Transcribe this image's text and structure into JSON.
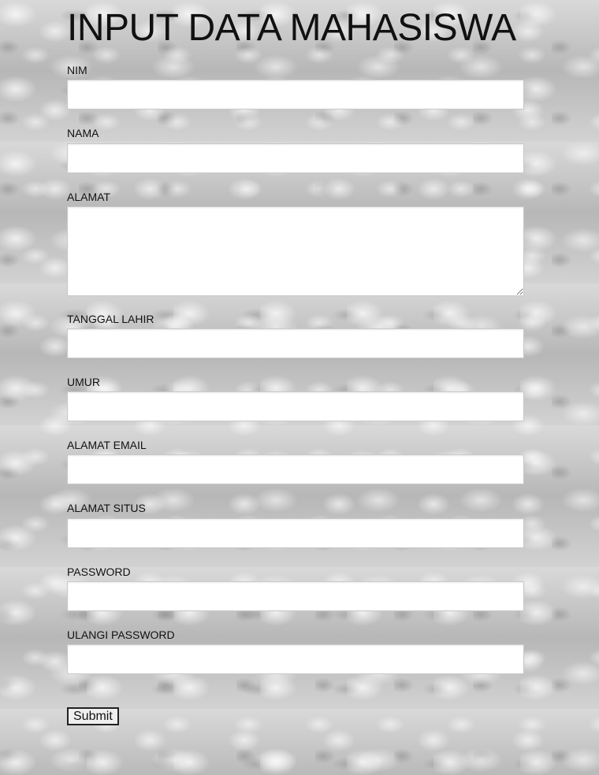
{
  "page": {
    "title": "INPUT DATA MAHASISWA"
  },
  "form": {
    "fields": [
      {
        "label": "NIM",
        "value": "",
        "placeholder": ""
      },
      {
        "label": "NAMA",
        "value": "",
        "placeholder": ""
      },
      {
        "label": "ALAMAT",
        "value": "",
        "placeholder": ""
      },
      {
        "label": "TANGGAL LAHIR",
        "value": "",
        "placeholder": ""
      },
      {
        "label": "UMUR",
        "value": "",
        "placeholder": ""
      },
      {
        "label": "ALAMAT EMAIL",
        "value": "",
        "placeholder": ""
      },
      {
        "label": "ALAMAT SITUS",
        "value": "",
        "placeholder": ""
      },
      {
        "label": "PASSWORD",
        "value": "",
        "placeholder": ""
      },
      {
        "label": "ULANGI PASSWORD",
        "value": "",
        "placeholder": ""
      }
    ],
    "submit_label": "Submit"
  },
  "colors": {
    "background": "#bdbdbd",
    "input_background": "#ffffff",
    "text": "#111111"
  }
}
